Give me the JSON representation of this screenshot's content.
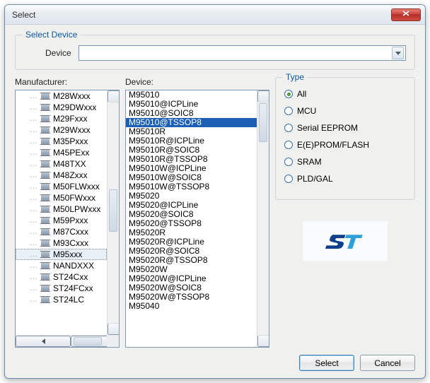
{
  "window": {
    "title": "Select"
  },
  "groupSelectDevice": {
    "label": "Select Device",
    "fieldLabel": "Device",
    "value": ""
  },
  "labels": {
    "manufacturer": "Manufacturer:",
    "device": "Device:",
    "type": "Type"
  },
  "manufacturers": [
    "M28Wxxx",
    "M29DWxxx",
    "M29Fxxx",
    "M29Wxxx",
    "M35Pxxx",
    "M45PExx",
    "M48TXX",
    "M48Zxxx",
    "M50FLWxxx",
    "M50FWxxx",
    "M50LPWxxx",
    "M59Pxxx",
    "M87Cxxx",
    "M93Cxxx",
    "M95xxx",
    "NANDXXX",
    "ST24Cxx",
    "ST24FCxx",
    "ST24LC"
  ],
  "manufacturer_selected": "M95xxx",
  "devices": [
    "M95010",
    "M95010@ICPLine",
    "M95010@SOIC8",
    "M95010@TSSOP8",
    "M95010R",
    "M95010R@ICPLine",
    "M95010R@SOIC8",
    "M95010R@TSSOP8",
    "M95010W@ICPLine",
    "M95010W@SOIC8",
    "M95010W@TSSOP8",
    "M95020",
    "M95020@ICPLine",
    "M95020@SOIC8",
    "M95020@TSSOP8",
    "M95020R",
    "M95020R@ICPLine",
    "M95020R@SOIC8",
    "M95020R@TSSOP8",
    "M95020W",
    "M95020W@ICPLine",
    "M95020W@SOIC8",
    "M95020W@TSSOP8",
    "M95040"
  ],
  "device_selected": "M95010@TSSOP8",
  "typeOptions": [
    "All",
    "MCU",
    "Serial EEPROM",
    "E(E)PROM/FLASH",
    "SRAM",
    "PLD/GAL"
  ],
  "type_selected": "All",
  "logo": {
    "name": "ST",
    "color1": "#0d3f8a",
    "color2": "#2fa0d8"
  },
  "buttons": {
    "select": "Select",
    "cancel": "Cancel"
  }
}
